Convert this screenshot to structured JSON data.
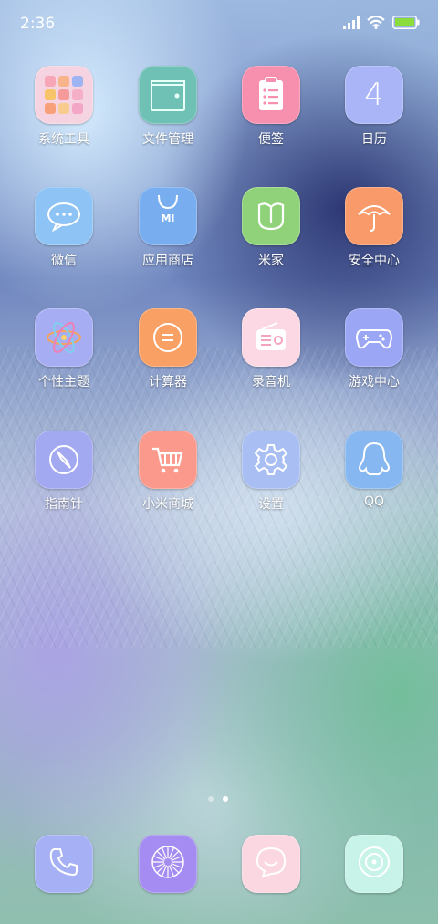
{
  "statusbar": {
    "time": "2:36",
    "icons": [
      "signal-icon",
      "wifi-icon",
      "battery-icon"
    ]
  },
  "apps": [
    {
      "label": "系统工具",
      "icon": "folder-grid-icon",
      "color": "#f6d3e0"
    },
    {
      "label": "文件管理",
      "icon": "file-folder-icon",
      "color": "#6fc1b5"
    },
    {
      "label": "便签",
      "icon": "notes-icon",
      "color": "#f78fae"
    },
    {
      "label": "日历",
      "icon": "calendar-icon",
      "color": "#a9b5f7",
      "day": "4"
    },
    {
      "label": "微信",
      "icon": "chat-bubble-icon",
      "color": "#8ec3f5"
    },
    {
      "label": "应用商店",
      "icon": "shopping-bag-icon",
      "color": "#78aef0",
      "badge": "MI"
    },
    {
      "label": "米家",
      "icon": "mijia-icon",
      "color": "#8fd27a"
    },
    {
      "label": "安全中心",
      "icon": "umbrella-icon",
      "color": "#f99a6a"
    },
    {
      "label": "个性主题",
      "icon": "atom-icon",
      "color": "#a7adf2"
    },
    {
      "label": "计算器",
      "icon": "equals-icon",
      "color": "#f9a065"
    },
    {
      "label": "录音机",
      "icon": "radio-icon",
      "color": "#fbd8e3"
    },
    {
      "label": "游戏中心",
      "icon": "gamepad-icon",
      "color": "#9ba6f4"
    },
    {
      "label": "指南针",
      "icon": "compass-icon",
      "color": "#a3a9f1"
    },
    {
      "label": "小米商城",
      "icon": "cart-icon",
      "color": "#fb9a8c"
    },
    {
      "label": "设置",
      "icon": "gear-icon",
      "color": "#a9bff4"
    },
    {
      "label": "QQ",
      "icon": "penguin-icon",
      "color": "#86b7f0"
    }
  ],
  "page_indicator": {
    "count": 2,
    "active": 2
  },
  "dock": [
    {
      "icon": "phone-icon",
      "color": "#a6b1f5"
    },
    {
      "icon": "camera-shutter-icon",
      "color": "#a58cf2"
    },
    {
      "icon": "message-bubble-icon",
      "color": "#fbd7e2"
    },
    {
      "icon": "browser-icon",
      "color": "#c8f3e8"
    }
  ]
}
